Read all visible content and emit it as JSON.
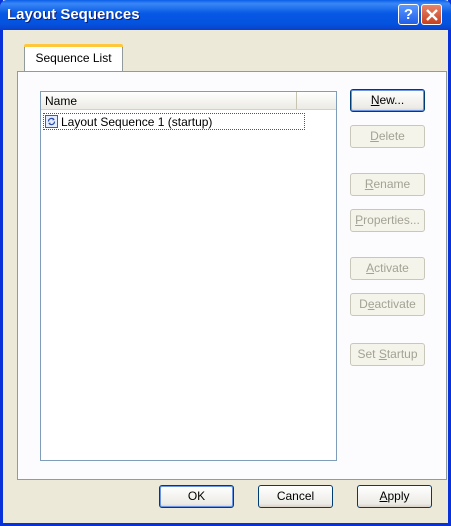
{
  "window": {
    "title": "Layout Sequences"
  },
  "titlebar_buttons": {
    "help": "?"
  },
  "tabs": [
    {
      "label": "Sequence List"
    }
  ],
  "list": {
    "column_header": "Name",
    "rows": [
      {
        "label": "Layout Sequence 1 (startup)",
        "icon": "sequence-icon"
      }
    ]
  },
  "side_buttons": [
    {
      "pre": "",
      "key": "N",
      "post": "ew...",
      "enabled": true
    },
    {
      "pre": "",
      "key": "D",
      "post": "elete",
      "enabled": false
    },
    {
      "pre": "",
      "key": "R",
      "post": "ename",
      "enabled": false
    },
    {
      "pre": "",
      "key": "P",
      "post": "roperties...",
      "enabled": false
    },
    {
      "pre": "",
      "key": "A",
      "post": "ctivate",
      "enabled": false
    },
    {
      "pre": "D",
      "key": "e",
      "post": "activate",
      "enabled": false
    },
    {
      "pre": "Set ",
      "key": "S",
      "post": "tartup",
      "enabled": false
    }
  ],
  "bottom_buttons": {
    "ok": "OK",
    "cancel": "Cancel",
    "apply": {
      "pre": "",
      "key": "A",
      "post": "pply"
    }
  },
  "colors": {
    "titlebar": "#0758e5",
    "tab_accent": "#ffc83c",
    "dialog_bg": "#ece9d8"
  }
}
